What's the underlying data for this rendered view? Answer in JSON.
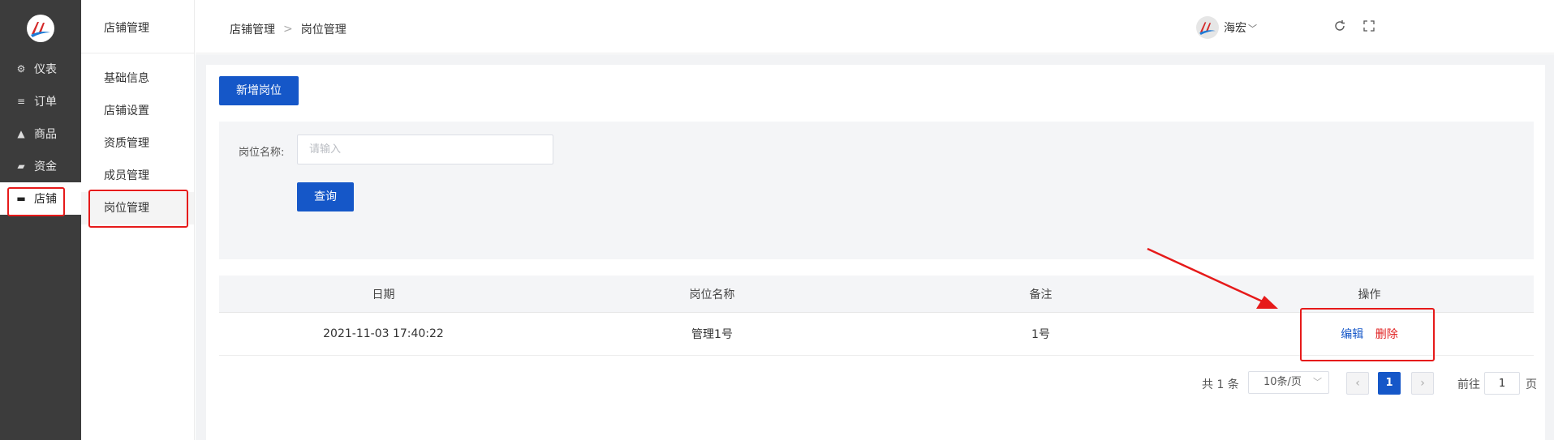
{
  "sidebar": {
    "items": [
      {
        "icon": "dashboard-icon",
        "glyph": "⚙",
        "label": "仪表"
      },
      {
        "icon": "list-icon",
        "glyph": "≡",
        "label": "订单"
      },
      {
        "icon": "bag-icon",
        "glyph": "▲",
        "label": "商品"
      },
      {
        "icon": "wallet-icon",
        "glyph": "▰",
        "label": "资金"
      },
      {
        "icon": "store-icon",
        "glyph": "▬",
        "label": "店铺"
      }
    ],
    "active_index": 4
  },
  "subnav": {
    "title": "店铺管理",
    "items": [
      {
        "label": "基础信息"
      },
      {
        "label": "店铺设置"
      },
      {
        "label": "资质管理"
      },
      {
        "label": "成员管理"
      },
      {
        "label": "岗位管理"
      }
    ],
    "active_index": 4
  },
  "header": {
    "breadcrumb": [
      "店铺管理",
      "岗位管理"
    ],
    "separator": ">",
    "refresh_icon": "refresh-icon",
    "fullscreen_icon": "fullscreen-icon",
    "user": {
      "name": "海宏",
      "dropdown_icon": "chevron-down-icon"
    }
  },
  "actions": {
    "add_label": "新增岗位"
  },
  "filter": {
    "label": "岗位名称:",
    "placeholder": "请输入",
    "value": "",
    "search_label": "查询"
  },
  "table": {
    "columns": [
      "日期",
      "岗位名称",
      "备注",
      "操作"
    ],
    "rows": [
      {
        "date": "2021-11-03 17:40:22",
        "name": "管理1号",
        "note": "1号",
        "edit": "编辑",
        "delete": "删除"
      }
    ]
  },
  "pagination": {
    "total_text": "共 1 条",
    "page_size": "10条/页",
    "current_page": "1",
    "goto_label": "前往",
    "goto_value": "1",
    "page_suffix": "页"
  },
  "colors": {
    "primary": "#1557c8",
    "danger": "#e02020",
    "sidebar_bg": "#3c3c3c",
    "annotation": "#e61a1a"
  }
}
